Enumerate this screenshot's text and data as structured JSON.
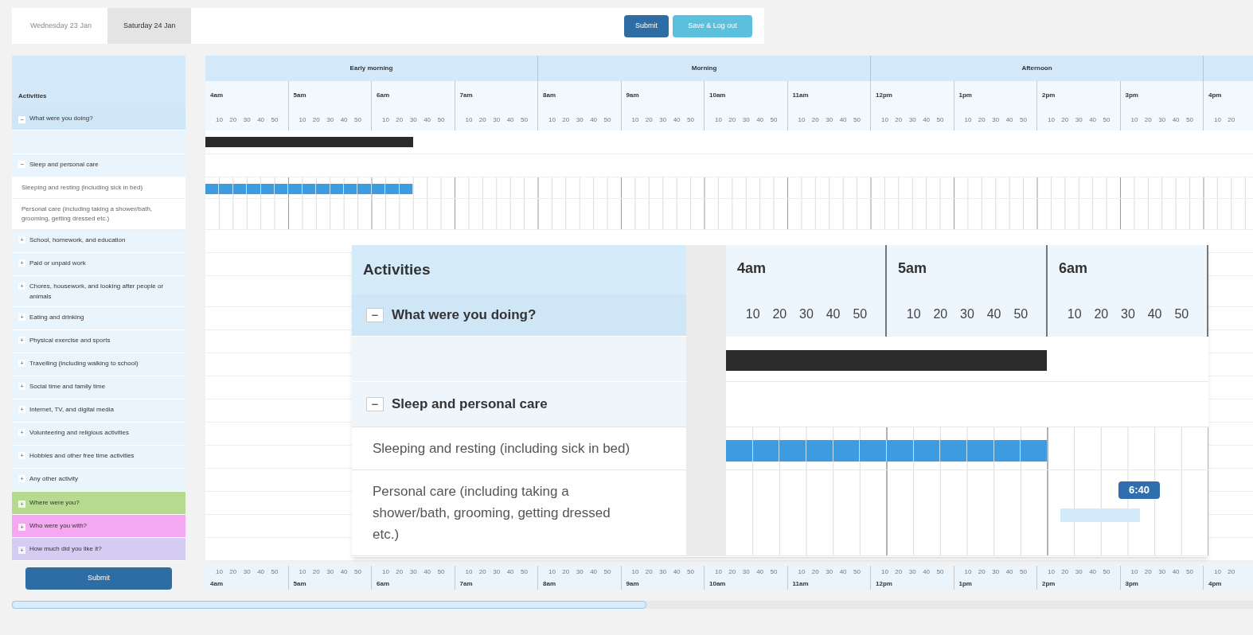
{
  "date_tabs": [
    {
      "label": "Wednesday 23 Jan",
      "selected": false
    },
    {
      "label": "Saturday 24 Jan",
      "selected": true
    }
  ],
  "top_buttons": [
    {
      "label": "Submit",
      "kind": "primary"
    },
    {
      "label": "Save & Log out",
      "kind": "secondary"
    }
  ],
  "sidebar": {
    "header": "Activities",
    "questions": [
      {
        "label": "What were you doing?",
        "toggle": "−",
        "expanded": true,
        "color": "#cfe6f7",
        "level": 0.198,
        "categories": [
          {
            "label": "Sleep and personal care",
            "toggle": "−",
            "expanded": true,
            "children": [
              {
                "label": "Sleeping and resting (including sick in bed)",
                "level": 0.198
              },
              {
                "label": "Personal care (including taking a shower/bath, grooming, getting dressed etc.)"
              }
            ]
          },
          {
            "label": "School, homework, and education",
            "toggle": "+",
            "expanded": false
          },
          {
            "label": "Paid or unpaid work",
            "toggle": "+",
            "expanded": false
          },
          {
            "label": "Chores, housework, and looking after people or animals",
            "toggle": "+",
            "expanded": false
          },
          {
            "label": "Eating and drinking",
            "toggle": "+",
            "expanded": false
          },
          {
            "label": "Physical exercise and sports",
            "toggle": "+",
            "expanded": false
          },
          {
            "label": "Travelling (including walking to school)",
            "toggle": "+",
            "expanded": false
          },
          {
            "label": "Social time and family time",
            "toggle": "+",
            "expanded": false
          },
          {
            "label": "Internet, TV, and digital media",
            "toggle": "+",
            "expanded": false
          },
          {
            "label": "Volunteering and religious activities",
            "toggle": "+",
            "expanded": false
          },
          {
            "label": "Hobbies and other free time activities",
            "toggle": "+",
            "expanded": false
          },
          {
            "label": "Any other activity",
            "toggle": "+",
            "expanded": false
          }
        ]
      },
      {
        "label": "Where were you?",
        "toggle": "+",
        "expanded": false,
        "color": "#b6da8f"
      },
      {
        "label": "Who were you with?",
        "toggle": "+",
        "expanded": false,
        "color": "#f4a8f1"
      },
      {
        "label": "How much did you like it?",
        "toggle": "+",
        "expanded": false,
        "color": "#d5ccf1"
      }
    ],
    "submit": "Submit"
  },
  "timeline": {
    "periods": [
      "Early morning",
      "Morning",
      "Afternoon"
    ],
    "hours": [
      {
        "label": "4am",
        "minutes": [
          "10",
          "20",
          "30",
          "40",
          "50"
        ]
      },
      {
        "label": "5am",
        "minutes": [
          "10",
          "20",
          "30",
          "40",
          "50"
        ]
      },
      {
        "label": "6am",
        "minutes": [
          "10",
          "20",
          "30",
          "40",
          "50"
        ]
      },
      {
        "label": "7am",
        "minutes": [
          "10",
          "20",
          "30",
          "40",
          "50"
        ]
      },
      {
        "label": "8am",
        "minutes": [
          "10",
          "20",
          "30",
          "40",
          "50"
        ]
      },
      {
        "label": "9am",
        "minutes": [
          "10",
          "20",
          "30",
          "40",
          "50"
        ]
      },
      {
        "label": "10am",
        "minutes": [
          "10",
          "20",
          "30",
          "40",
          "50"
        ]
      },
      {
        "label": "11am",
        "minutes": [
          "10",
          "20",
          "30",
          "40",
          "50"
        ]
      },
      {
        "label": "12pm",
        "minutes": [
          "10",
          "20",
          "30",
          "40",
          "50"
        ]
      },
      {
        "label": "1pm",
        "minutes": [
          "10",
          "20",
          "30",
          "40",
          "50"
        ]
      },
      {
        "label": "2pm",
        "minutes": [
          "10",
          "20",
          "30",
          "40",
          "50"
        ]
      },
      {
        "label": "3pm",
        "minutes": [
          "10",
          "20",
          "30",
          "40",
          "50"
        ]
      },
      {
        "label": "4pm",
        "minutes": [
          "10",
          "20"
        ]
      }
    ],
    "bottom_hours": [
      {
        "label": "4am",
        "minutes": [
          "10",
          "20",
          "30",
          "40",
          "50"
        ]
      },
      {
        "label": "5am",
        "minutes": [
          "10",
          "20",
          "30",
          "40",
          "50"
        ]
      },
      {
        "label": "6am",
        "minutes": [
          "10",
          "20",
          "30",
          "40",
          "50"
        ]
      },
      {
        "label": "7am",
        "minutes": [
          "10",
          "20",
          "30",
          "40",
          "50"
        ]
      },
      {
        "label": "8am",
        "minutes": [
          "10",
          "20",
          "30",
          "40",
          "50"
        ]
      },
      {
        "label": "9am",
        "minutes": [
          "10",
          "20",
          "30",
          "40",
          "50"
        ]
      },
      {
        "label": "10am",
        "minutes": [
          "10",
          "20",
          "30",
          "40",
          "50"
        ]
      },
      {
        "label": "11am",
        "minutes": [
          "10",
          "20",
          "30",
          "40",
          "50"
        ]
      },
      {
        "label": "12pm",
        "minutes": [
          "10",
          "20",
          "30",
          "40",
          "50"
        ]
      },
      {
        "label": "1pm",
        "minutes": [
          "10",
          "20",
          "30",
          "40",
          "50"
        ]
      },
      {
        "label": "2pm",
        "minutes": [
          "10",
          "20",
          "30",
          "40",
          "50"
        ]
      },
      {
        "label": "3pm",
        "minutes": [
          "10",
          "20",
          "30",
          "40",
          "50"
        ]
      },
      {
        "label": "4pm",
        "minutes": [
          "10",
          "20"
        ]
      }
    ]
  },
  "magnifier": {
    "header": "Activities",
    "question": {
      "label": "What were you doing?",
      "toggle": "−",
      "expanded": true,
      "level": 0.665,
      "categories": [
        {
          "label": "Sleep and personal care",
          "toggle": "−",
          "expanded": true,
          "children": [
            {
              "label": "Sleeping and resting (including sick in bed)",
              "level": 0.665
            },
            {
              "label": "Personal care (including taking a shower/bath, grooming, getting dressed etc.)",
              "tooltip": "6:40"
            }
          ]
        }
      ]
    },
    "hours": [
      {
        "label": "4am",
        "minutes": [
          "10",
          "20",
          "30",
          "40",
          "50"
        ]
      },
      {
        "label": "5am",
        "minutes": [
          "10",
          "20",
          "30",
          "40",
          "50"
        ]
      },
      {
        "label": "6am",
        "minutes": [
          "10",
          "20",
          "30",
          "40",
          "50"
        ]
      }
    ]
  }
}
